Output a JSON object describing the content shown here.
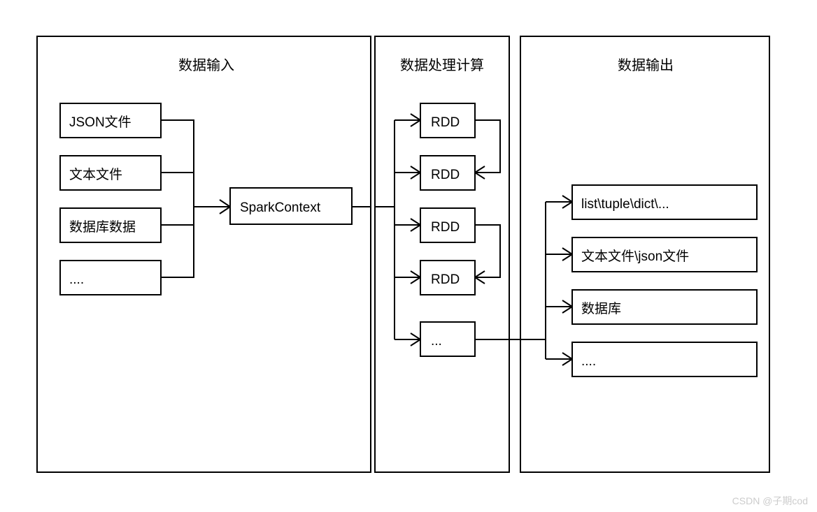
{
  "titles": {
    "input": "数据输入",
    "processing": "数据处理计算",
    "output": "数据输出"
  },
  "input_boxes": {
    "json": "JSON文件",
    "text": "文本文件",
    "db": "数据库数据",
    "etc": "....",
    "context": "SparkContext"
  },
  "processing_boxes": {
    "rdd1": "RDD",
    "rdd2": "RDD",
    "rdd3": "RDD",
    "rdd4": "RDD",
    "etc": "..."
  },
  "output_boxes": {
    "struct": "list\\tuple\\dict\\...",
    "file": "文本文件\\json文件",
    "db": "数据库",
    "etc": "...."
  },
  "watermark": "CSDN @子期cod"
}
